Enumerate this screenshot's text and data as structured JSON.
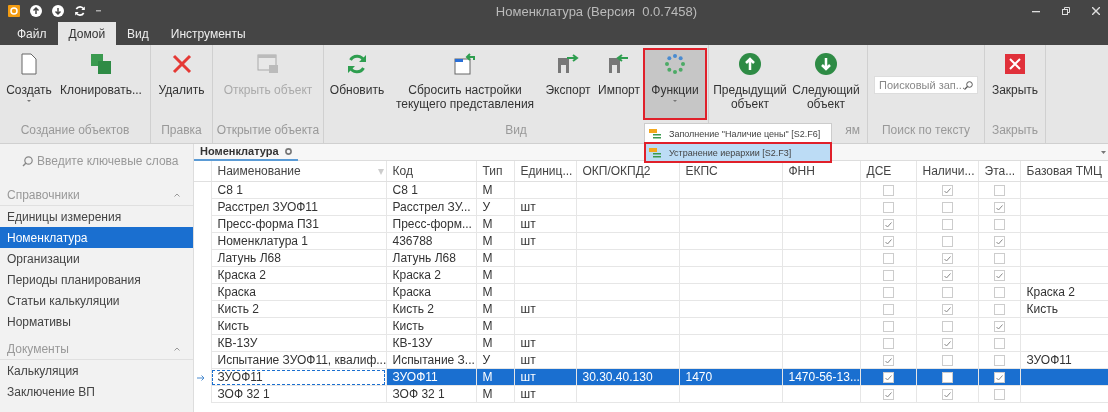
{
  "window": {
    "title": "Номенклатура (Версия  0.0.7458)"
  },
  "menu_tabs": [
    {
      "label": "Файл",
      "selected": false
    },
    {
      "label": "Домой",
      "selected": true
    },
    {
      "label": "Вид",
      "selected": false
    },
    {
      "label": "Инструменты",
      "selected": false
    }
  ],
  "ribbon_groups": [
    {
      "label": "Создание объектов",
      "buttons": [
        {
          "label": "Создать",
          "disabled": false,
          "dropdown": true,
          "pressed": false,
          "annotated": false
        },
        {
          "label": "Клонировать...",
          "disabled": false,
          "dropdown": false,
          "pressed": false,
          "annotated": false
        }
      ]
    },
    {
      "label": "Правка",
      "buttons": [
        {
          "label": "Удалить",
          "disabled": false,
          "dropdown": false,
          "pressed": false,
          "annotated": false
        }
      ]
    },
    {
      "label": "Открытие объекта",
      "buttons": [
        {
          "label": "Открыть объект",
          "disabled": true,
          "dropdown": false,
          "pressed": false,
          "annotated": false
        }
      ]
    },
    {
      "label": "Вид",
      "buttons": [
        {
          "label": "Обновить",
          "disabled": false,
          "dropdown": false,
          "pressed": false,
          "annotated": false
        },
        {
          "label": "Сбросить настройки текущего представления",
          "disabled": false,
          "dropdown": false,
          "pressed": false,
          "annotated": false
        },
        {
          "label": "Экспорт",
          "disabled": false,
          "dropdown": false,
          "pressed": false,
          "annotated": false
        },
        {
          "label": "Импорт",
          "disabled": false,
          "dropdown": false,
          "pressed": false,
          "annotated": false
        },
        {
          "label": "Функции",
          "disabled": false,
          "dropdown": true,
          "pressed": true,
          "annotated": true
        }
      ]
    },
    {
      "label": "ям",
      "buttons": [
        {
          "label": "Предыдущий объект",
          "disabled": false,
          "dropdown": false,
          "pressed": false,
          "annotated": false
        },
        {
          "label": "Следующий объект",
          "disabled": false,
          "dropdown": false,
          "pressed": false,
          "annotated": false
        }
      ]
    },
    {
      "label": "Поиск по тексту",
      "search": {
        "placeholder": "Поисковый зап..."
      }
    },
    {
      "label": "Закрыть",
      "buttons": [
        {
          "label": "Закрыть",
          "disabled": false,
          "dropdown": false,
          "pressed": false,
          "annotated": false
        }
      ]
    }
  ],
  "functions_menu": [
    {
      "label": "Заполнение \"Наличие цены\" [S2.F6]",
      "selected": false,
      "annotated": false
    },
    {
      "label": "Устранение иерархии [S2.F3]",
      "selected": true,
      "annotated": true
    }
  ],
  "sidebar": {
    "search": {
      "placeholder": "Введите ключевые слова"
    },
    "sections": [
      {
        "title": "Справочники",
        "expanded": true,
        "items": [
          {
            "label": "Единицы измерения",
            "selected": false
          },
          {
            "label": "Номенклатура",
            "selected": true
          },
          {
            "label": "Организации",
            "selected": false
          },
          {
            "label": "Периоды планирования",
            "selected": false
          },
          {
            "label": "Статьи калькуляции",
            "selected": false
          },
          {
            "label": "Нормативы",
            "selected": false
          }
        ]
      },
      {
        "title": "Документы",
        "expanded": true,
        "items": [
          {
            "label": "Калькуляция",
            "selected": false
          },
          {
            "label": "Заключение ВП",
            "selected": false
          }
        ]
      }
    ]
  },
  "document_tab": {
    "label": "Номенклатура"
  },
  "table": {
    "columns": [
      {
        "label": "Наименование",
        "kind": "text",
        "filter": true
      },
      {
        "label": "Код",
        "kind": "text",
        "filter": false
      },
      {
        "label": "Тип",
        "kind": "text",
        "filter": false
      },
      {
        "label": "Единиц...",
        "kind": "text",
        "filter": false
      },
      {
        "label": "ОКП/ОКПД2",
        "kind": "text",
        "filter": false
      },
      {
        "label": "ЕКПС",
        "kind": "text",
        "filter": false
      },
      {
        "label": "ФНН",
        "kind": "text",
        "filter": false
      },
      {
        "label": "ДСЕ",
        "kind": "check",
        "filter": false
      },
      {
        "label": "Наличи...",
        "kind": "check",
        "filter": false
      },
      {
        "label": "Эта...",
        "kind": "check",
        "filter": false
      },
      {
        "label": "Базовая ТМЦ",
        "kind": "text",
        "filter": false
      }
    ],
    "rows": [
      {
        "selected": false,
        "cells": [
          "С8 1",
          "С8 1",
          "М",
          "",
          "",
          "",
          "",
          false,
          true,
          false,
          ""
        ]
      },
      {
        "selected": false,
        "cells": [
          "Расстрел ЗУОФ11",
          "Расстрел ЗУ...",
          "У",
          "шт",
          "",
          "",
          "",
          false,
          false,
          true,
          ""
        ]
      },
      {
        "selected": false,
        "cells": [
          "Пресс-форма П31",
          "Пресс-форм...",
          "М",
          "шт",
          "",
          "",
          "",
          true,
          false,
          false,
          ""
        ]
      },
      {
        "selected": false,
        "cells": [
          "Номенклатура 1",
          "436788",
          "М",
          "шт",
          "",
          "",
          "",
          true,
          false,
          true,
          ""
        ]
      },
      {
        "selected": false,
        "cells": [
          "Латунь Л68",
          "Латунь Л68",
          "М",
          "",
          "",
          "",
          "",
          false,
          true,
          false,
          ""
        ]
      },
      {
        "selected": false,
        "cells": [
          "Краска 2",
          "Краска 2",
          "М",
          "",
          "",
          "",
          "",
          false,
          true,
          true,
          ""
        ]
      },
      {
        "selected": false,
        "cells": [
          "Краска",
          "Краска",
          "М",
          "",
          "",
          "",
          "",
          false,
          false,
          false,
          "Краска 2"
        ]
      },
      {
        "selected": false,
        "cells": [
          "Кисть 2",
          "Кисть 2",
          "М",
          "шт",
          "",
          "",
          "",
          false,
          true,
          false,
          "Кисть"
        ]
      },
      {
        "selected": false,
        "cells": [
          "Кисть",
          "Кисть",
          "М",
          "",
          "",
          "",
          "",
          false,
          false,
          true,
          ""
        ]
      },
      {
        "selected": false,
        "cells": [
          "КВ-13У",
          "КВ-13У",
          "М",
          "шт",
          "",
          "",
          "",
          false,
          true,
          false,
          ""
        ]
      },
      {
        "selected": false,
        "cells": [
          "Испытание ЗУОФ11, квалиф...",
          "Испытание З...",
          "У",
          "шт",
          "",
          "",
          "",
          true,
          false,
          false,
          "ЗУОФ11"
        ]
      },
      {
        "selected": true,
        "cells": [
          "ЗУОФ11",
          "ЗУОФ11",
          "М",
          "шт",
          "30.30.40.130",
          "1470",
          "1470-56-13...",
          true,
          false,
          true,
          ""
        ]
      },
      {
        "selected": false,
        "cells": [
          "ЗОФ 32 1",
          "ЗОФ 32 1",
          "М",
          "шт",
          "",
          "",
          "",
          true,
          true,
          false,
          ""
        ]
      }
    ]
  }
}
